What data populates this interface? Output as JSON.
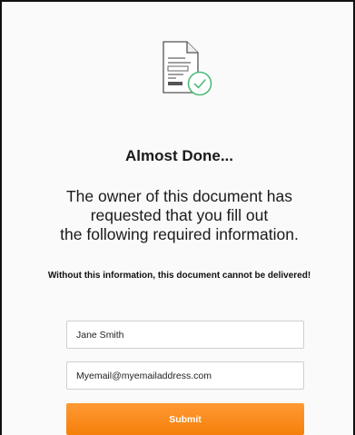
{
  "icon": "document-check-icon",
  "title": "Almost Done...",
  "message_lines": [
    "The owner of this document has",
    "requested that you fill out",
    "the following required information."
  ],
  "warning": "Without this information, this document cannot be delivered!",
  "form": {
    "name_value": "Jane Smith",
    "email_value": "Myemail@myemailaddress.com",
    "submit_label": "Submit"
  },
  "colors": {
    "accent": "#f5800b",
    "check": "#4cbb7a"
  }
}
